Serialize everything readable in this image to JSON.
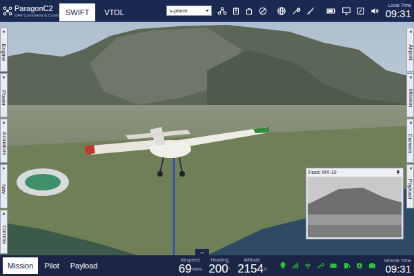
{
  "app": {
    "name": "ParagonC2",
    "subtitle": "UAV Command & Control"
  },
  "top_tabs": [
    {
      "label": "SWIFT",
      "selected": true
    },
    {
      "label": "VTOL",
      "selected": false
    }
  ],
  "vehicle_select": {
    "value": "s-plane"
  },
  "local_time": {
    "label": "Local Time",
    "value": "09:31"
  },
  "left_panels": [
    "Engine",
    "Power",
    "Actuators",
    "Nav",
    "Comms"
  ],
  "right_panels": [
    "Airport",
    "Mission",
    "Camera",
    "Payload"
  ],
  "video_feed": {
    "title": "Feed: MX-10"
  },
  "bottom_tabs": [
    {
      "label": "Mission",
      "selected": true
    },
    {
      "label": "Pilot",
      "selected": false
    },
    {
      "label": "Payload",
      "selected": false
    }
  ],
  "readouts": [
    {
      "label": "Airspeed",
      "value": "69",
      "unit": "KIAS"
    },
    {
      "label": "Heading",
      "value": "200",
      "unit": "°"
    },
    {
      "label": "Altitude",
      "value": "2154",
      "unit": "ft"
    }
  ],
  "vehicle_time": {
    "label": "Vehicle Time",
    "value": "09:31"
  }
}
